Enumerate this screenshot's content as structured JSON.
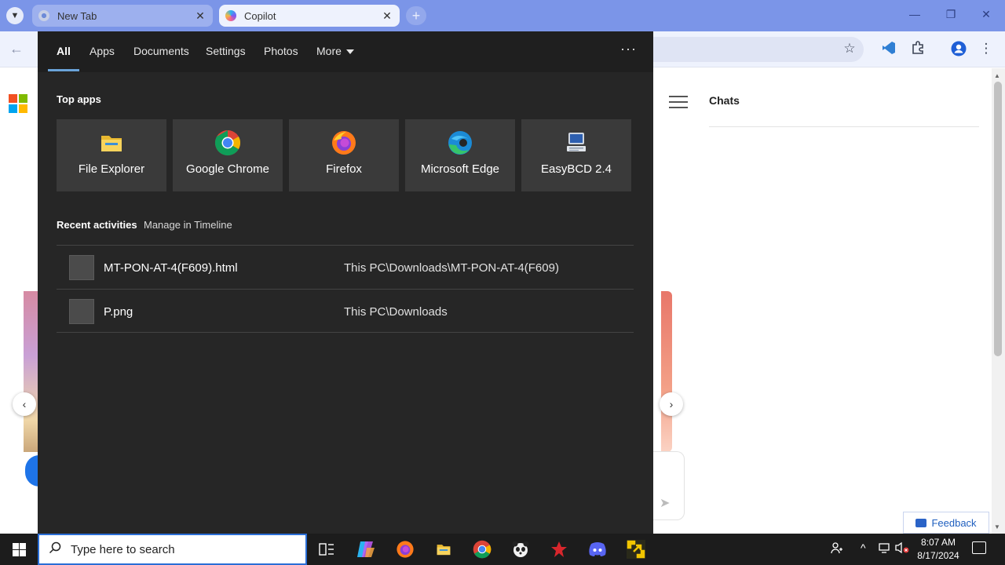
{
  "browser": {
    "tabs": [
      {
        "title": "New Tab",
        "active": false
      },
      {
        "title": "Copilot",
        "active": true
      }
    ],
    "close_glyph": "✕",
    "new_tab_glyph": "+",
    "window_controls": {
      "minimize": "—",
      "restore": "❐",
      "close": "✕"
    }
  },
  "page": {
    "chats_title": "Chats",
    "feedback_label": "Feedback"
  },
  "search_panel": {
    "tabs": [
      {
        "label": "All",
        "active": true
      },
      {
        "label": "Apps"
      },
      {
        "label": "Documents"
      },
      {
        "label": "Settings"
      },
      {
        "label": "Photos"
      },
      {
        "label": "More"
      }
    ],
    "options_glyph": "···",
    "top_apps_title": "Top apps",
    "top_apps": [
      {
        "name": "File Explorer",
        "icon": "folder-icon"
      },
      {
        "name": "Google Chrome",
        "icon": "chrome-icon"
      },
      {
        "name": "Firefox",
        "icon": "firefox-icon"
      },
      {
        "name": "Microsoft Edge",
        "icon": "edge-icon"
      },
      {
        "name": "EasyBCD 2.4",
        "icon": "easybcd-icon"
      }
    ],
    "recent_title": "Recent activities",
    "recent_link": "Manage in Timeline",
    "recent_items": [
      {
        "name": "MT-PON-AT-4(F609).html",
        "path": "This PC\\Downloads\\MT-PON-AT-4(F609)"
      },
      {
        "name": "P.png",
        "path": "This PC\\Downloads"
      }
    ]
  },
  "taskbar": {
    "search_placeholder": "Type here to search",
    "pinned": [
      "task-view-icon",
      "copilot-icon",
      "firefox-icon",
      "file-explorer-icon",
      "chrome-icon",
      "panda-app-icon",
      "red-app-icon",
      "discord-icon",
      "yellow-app-icon"
    ],
    "clock_time": "8:07 AM",
    "clock_date": "8/17/2024"
  },
  "colors": {
    "tabstrip": "#7b95e8",
    "panel_bg": "#262626",
    "tile_bg": "#3a3a3a",
    "accent_blue": "#2a6ed6",
    "taskbar_bg": "#1c1c1c"
  }
}
